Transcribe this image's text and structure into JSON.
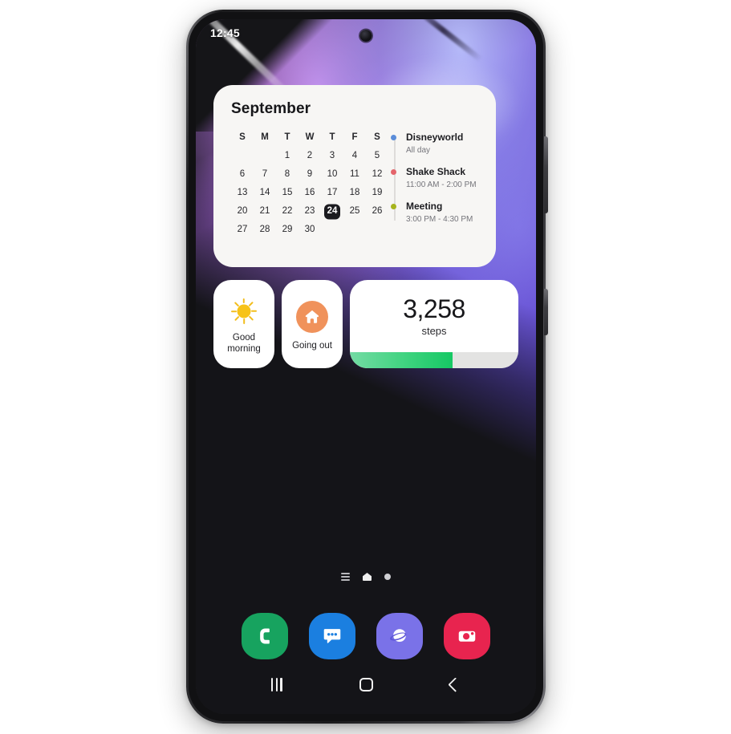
{
  "device": {
    "name": "samsung-galaxy-phone",
    "status_bar": {
      "time": "12:45"
    }
  },
  "calendar_widget": {
    "month": "September",
    "day_initials": [
      "S",
      "M",
      "T",
      "W",
      "T",
      "F",
      "S"
    ],
    "weeks": [
      [
        "",
        "",
        "1",
        "2",
        "3",
        "4",
        "5"
      ],
      [
        "6",
        "7",
        "8",
        "9",
        "10",
        "11",
        "12"
      ],
      [
        "13",
        "14",
        "15",
        "16",
        "17",
        "18",
        "19"
      ],
      [
        "20",
        "21",
        "22",
        "23",
        "24",
        "25",
        "26"
      ],
      [
        "27",
        "28",
        "29",
        "30",
        "",
        "",
        ""
      ]
    ],
    "today": "24",
    "events": [
      {
        "title": "Disneyworld",
        "time": "All day",
        "dot_color": "#5b8dd9"
      },
      {
        "title": "Shake Shack",
        "time": "11:00 AM - 2:00 PM",
        "dot_color": "#e4646b"
      },
      {
        "title": "Meeting",
        "time": "3:00 PM - 4:30 PM",
        "dot_color": "#a6b41e"
      }
    ]
  },
  "widgets": {
    "routine_morning": {
      "label": "Good\nmorning",
      "icon": "sun-icon",
      "icon_color": "#f7c318"
    },
    "routine_going_out": {
      "label": "Going out",
      "icon": "house-icon",
      "icon_color": "#f0925b"
    },
    "steps": {
      "count": "3,258",
      "unit": "steps",
      "progress_percent": 61,
      "fill_color": "#16c864",
      "track_color": "#e3e3e2"
    }
  },
  "page_indicator": {
    "items": [
      {
        "name": "apps-page-icon",
        "type": "lines"
      },
      {
        "name": "home-page-icon",
        "type": "home",
        "active": true
      },
      {
        "name": "page-dot",
        "type": "dot"
      }
    ]
  },
  "dock": {
    "items": [
      {
        "name": "phone-app-icon",
        "label": "Phone",
        "color": "#17a35f"
      },
      {
        "name": "messages-app-icon",
        "label": "Messages",
        "color": "#1b7fe0"
      },
      {
        "name": "internet-app-icon",
        "label": "Internet",
        "color": "#7a72e8"
      },
      {
        "name": "camera-app-icon",
        "label": "Camera",
        "color": "#e8244f"
      }
    ]
  },
  "nav_bar": {
    "items": [
      {
        "name": "recents-button",
        "label": "Recents"
      },
      {
        "name": "home-button",
        "label": "Home"
      },
      {
        "name": "back-button",
        "label": "Back"
      }
    ]
  }
}
